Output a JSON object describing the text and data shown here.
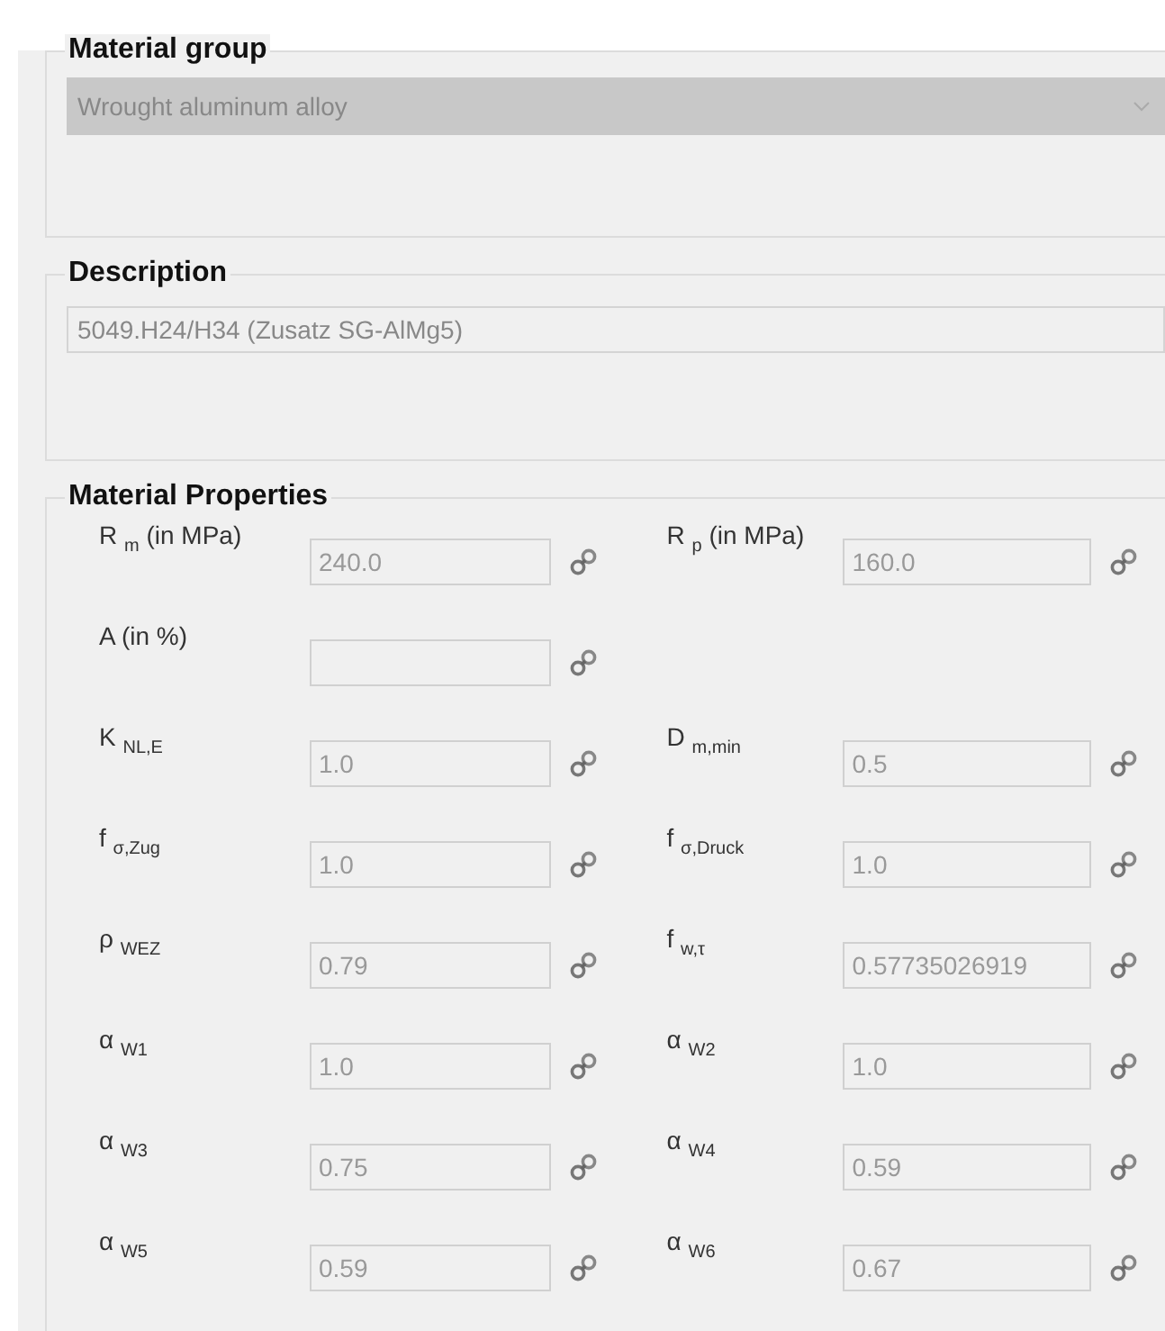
{
  "material_group": {
    "title": "Material group",
    "value": "Wrought aluminum alloy"
  },
  "description": {
    "title": "Description",
    "value": "5049.H24/H34 (Zusatz SG-AlMg5)"
  },
  "material_properties": {
    "title": "Material Properties",
    "rows": [
      [
        {
          "label": "R $_{m}$ (in MPa)",
          "value": "240.0"
        },
        {
          "label": "R $_{p}$ (in MPa)",
          "value": "160.0"
        }
      ],
      [
        {
          "label": "A (in %)"
        }
      ],
      [
        {
          "label": "K $_{NL,E}$",
          "value": "1.0"
        },
        {
          "label": "D $_{m,min}$",
          "value": "0.5"
        }
      ],
      [
        {
          "label": "f $_{σ,Zug}$",
          "value": "1.0"
        },
        {
          "label": "f $_{σ,Druck}$",
          "value": "1.0"
        }
      ],
      [
        {
          "label": "ρ $_{WEZ}$",
          "value": "0.79"
        },
        {
          "label": "f $_{w,τ}$",
          "value": "0.57735026919"
        }
      ],
      [
        {
          "label": "α $_{W1}$",
          "value": "1.0"
        },
        {
          "label": "α $_{W2}$",
          "value": "1.0"
        }
      ],
      [
        {
          "label": "α $_{W3}$",
          "value": "0.75"
        },
        {
          "label": "α $_{W4}$",
          "value": "0.59"
        }
      ],
      [
        {
          "label": "α $_{W5}$",
          "value": "0.59"
        },
        {
          "label": "α $_{W6}$",
          "value": "0.67"
        }
      ]
    ]
  }
}
